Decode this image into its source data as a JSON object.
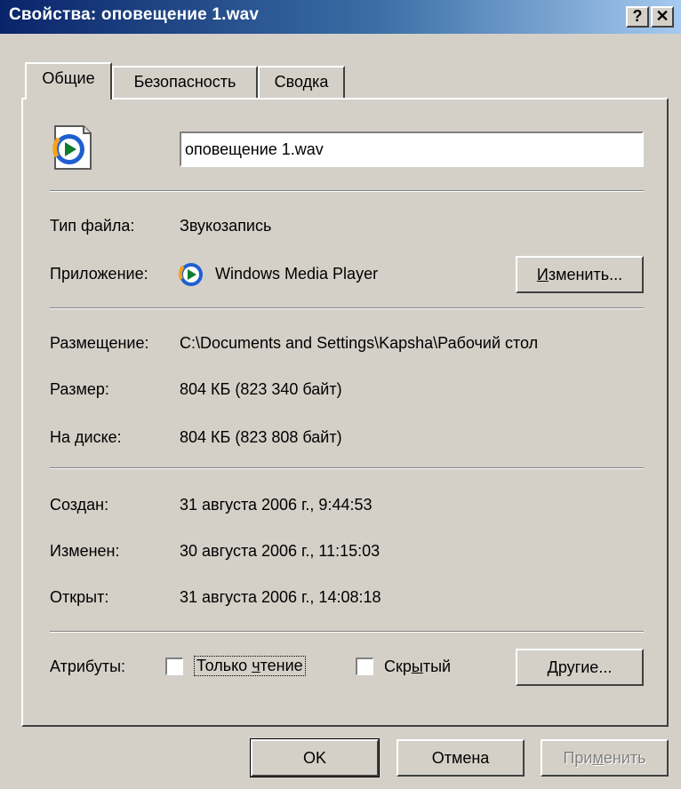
{
  "window": {
    "title": "Свойства: оповещение 1.wav",
    "help_glyph": "?",
    "close_glyph": "✕"
  },
  "tabs": [
    {
      "label": "Общие",
      "active": true
    },
    {
      "label": "Безопасность",
      "active": false
    },
    {
      "label": "Сводка",
      "active": false
    }
  ],
  "file": {
    "name_value": "оповещение 1.wav",
    "icon": "media-file-icon"
  },
  "info": {
    "type_label": "Тип файла:",
    "type_value": "Звукозапись",
    "app_label": "Приложение:",
    "app_icon": "windows-media-player-icon",
    "app_value": "Windows Media Player",
    "change_pre": "И",
    "change_rest": "зменить...",
    "location_label": "Размещение:",
    "location_value": "C:\\Documents and Settings\\Kapsha\\Рабочий стол",
    "size_label": "Размер:",
    "size_value": "804 КБ (823 340 байт)",
    "disk_label": "На диске:",
    "disk_value": "804 КБ (823 808 байт)",
    "created_label": "Создан:",
    "created_value": "31 августа 2006 г., 9:44:53",
    "modified_label": "Изменен:",
    "modified_value": "30 августа 2006 г., 11:15:03",
    "opened_label": "Открыт:",
    "opened_value": "31 августа 2006 г., 14:08:18"
  },
  "attributes": {
    "label": "Атрибуты:",
    "readonly_pre": "Только ",
    "readonly_u": "ч",
    "readonly_post": "тение",
    "readonly_checked": false,
    "hidden_pre": "Скр",
    "hidden_u": "ы",
    "hidden_post": "тый",
    "hidden_checked": false,
    "other_u": "Д",
    "other_rest": "ругие..."
  },
  "footer": {
    "ok_label": "OK",
    "cancel_label": "Отмена",
    "apply_pre": "При",
    "apply_u": "м",
    "apply_post": "енить",
    "apply_enabled": false
  },
  "colors": {
    "title_gradient_start": "#0a246a",
    "title_gradient_end": "#a6caf0",
    "face": "#d4d0c8"
  }
}
